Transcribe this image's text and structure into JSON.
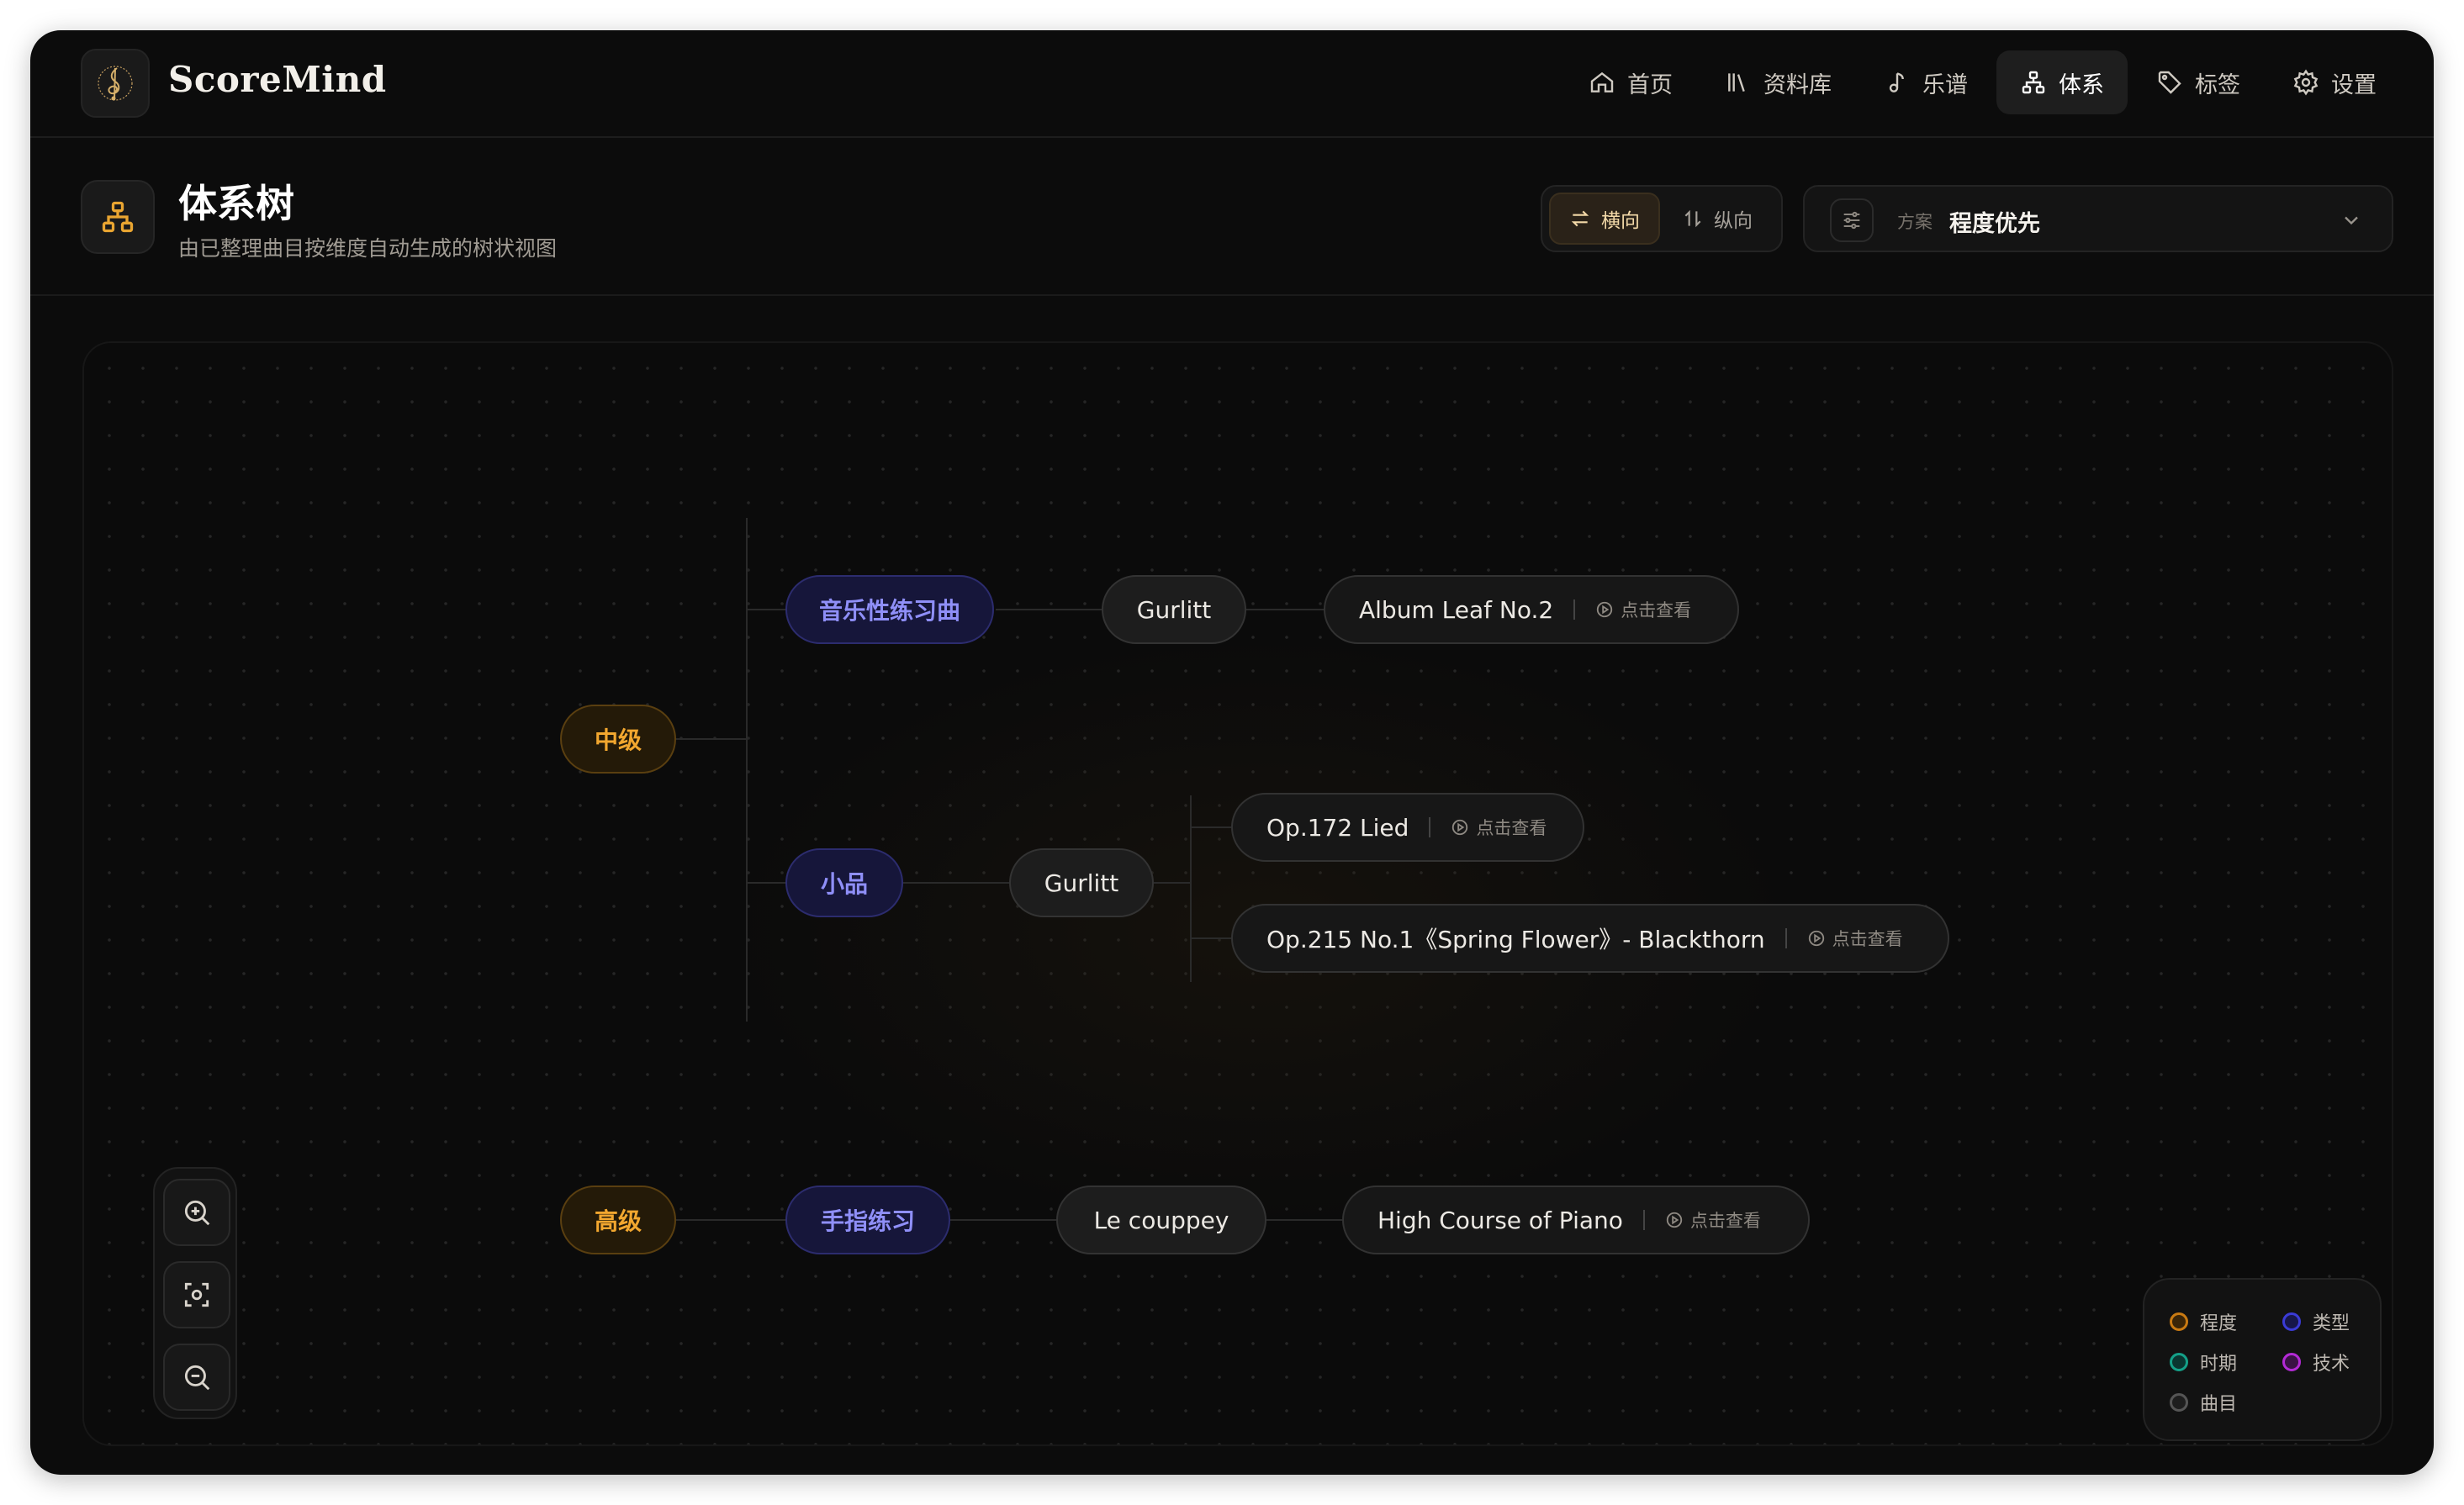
{
  "app": {
    "brand": "ScoreMind",
    "nav": [
      {
        "label": "首页",
        "icon": "home-icon"
      },
      {
        "label": "资料库",
        "icon": "library-icon"
      },
      {
        "label": "乐谱",
        "icon": "music-note-icon"
      },
      {
        "label": "体系",
        "icon": "hierarchy-icon",
        "active": true
      },
      {
        "label": "标签",
        "icon": "tag-icon"
      },
      {
        "label": "设置",
        "icon": "gear-icon"
      }
    ]
  },
  "header": {
    "title": "体系树",
    "subtitle": "由已整理曲目按维度自动生成的树状视图",
    "orientation": {
      "horizontal": "横向",
      "vertical": "纵向",
      "selected": "horizontal"
    },
    "scheme": {
      "label": "方案",
      "value": "程度优先"
    }
  },
  "tree": {
    "levels": [
      "中级",
      "高级"
    ],
    "types": [
      "音乐性练习曲",
      "小品",
      "手指练习"
    ],
    "composers": [
      "Gurlitt",
      "Gurlitt",
      "Le couppey"
    ],
    "pieces": [
      {
        "title": "Album Leaf No.2",
        "action": "点击查看"
      },
      {
        "title": "Op.172 Lied",
        "action": "点击查看"
      },
      {
        "title": "Op.215 No.1《Spring Flower》- Blackthorn",
        "action": "点击查看"
      },
      {
        "title": "High Course of Piano",
        "action": "点击查看"
      }
    ]
  },
  "legend": [
    {
      "label": "程度",
      "color": "#c97a12"
    },
    {
      "label": "类型",
      "color": "#3b3bd6"
    },
    {
      "label": "时期",
      "color": "#14a088"
    },
    {
      "label": "技术",
      "color": "#b32ad6"
    },
    {
      "label": "曲目",
      "color": "#555555"
    }
  ],
  "colors": {
    "accent": "#f2a72f",
    "type": "#8f8ff8"
  }
}
